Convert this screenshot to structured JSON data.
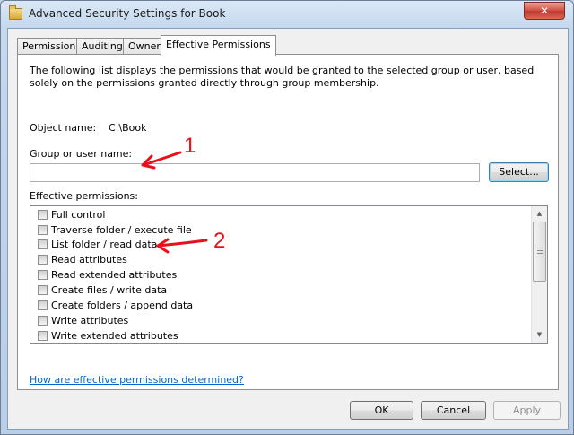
{
  "window": {
    "title": "Advanced Security Settings for Book",
    "close_glyph": "✕"
  },
  "tabs": [
    {
      "label": "Permissions",
      "active": false
    },
    {
      "label": "Auditing",
      "active": false
    },
    {
      "label": "Owner",
      "active": false
    },
    {
      "label": "Effective Permissions",
      "active": true
    }
  ],
  "panel": {
    "description": "The following list displays the permissions that would be granted to the selected group or user, based solely on the permissions granted directly through group membership.",
    "object_name_label": "Object name:",
    "object_name_value": "C:\\Book",
    "group_label": "Group or user name:",
    "group_value": "",
    "select_button": "Select...",
    "effective_label": "Effective permissions:",
    "permissions": [
      {
        "label": "Full control",
        "checked": false
      },
      {
        "label": "Traverse folder / execute file",
        "checked": false
      },
      {
        "label": "List folder / read data",
        "checked": false
      },
      {
        "label": "Read attributes",
        "checked": false
      },
      {
        "label": "Read extended attributes",
        "checked": false
      },
      {
        "label": "Create files / write data",
        "checked": false
      },
      {
        "label": "Create folders / append data",
        "checked": false
      },
      {
        "label": "Write attributes",
        "checked": false
      },
      {
        "label": "Write extended attributes",
        "checked": false
      }
    ],
    "help_link": "How are effective permissions determined?"
  },
  "buttons": {
    "ok": "OK",
    "cancel": "Cancel",
    "apply": "Apply"
  },
  "annotations": {
    "marker_1": "1",
    "marker_2": "2",
    "arrow_color": "#e8111b"
  },
  "scrollbar": {
    "up_glyph": "▲",
    "down_glyph": "▼"
  }
}
